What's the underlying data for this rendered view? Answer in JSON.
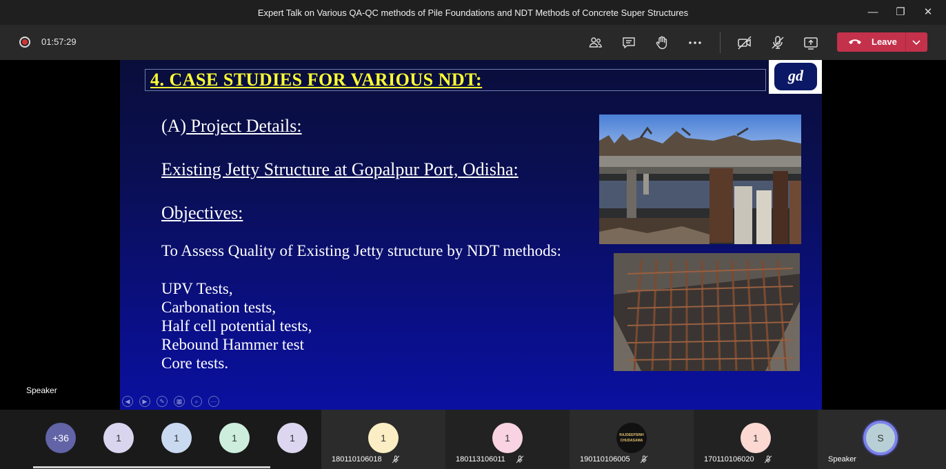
{
  "window": {
    "title": "Expert Talk on Various QA-QC methods of Pile Foundations and NDT Methods of Concrete Super Structures",
    "minimize": "—",
    "restore": "❐",
    "close": "✕"
  },
  "toolbar": {
    "timer": "01:57:29",
    "leave_label": "Leave",
    "icons": [
      "participants-icon",
      "chat-icon",
      "raise-hand-icon",
      "more-options-icon",
      "camera-off-icon",
      "mic-off-icon",
      "share-screen-icon"
    ],
    "leave_color": "#c4314b"
  },
  "slide": {
    "heading": "4.  CASE STUDIES FOR VARIOUS NDT:",
    "logo_text": "gd",
    "project_prefix": "(A)",
    "project_title": " Project Details:",
    "location": "Existing Jetty Structure at Gopalpur Port,  Odisha:",
    "objectives_heading": "Objectives:",
    "objective_text": "To Assess Quality of Existing Jetty structure by NDT methods:",
    "tests": [
      "UPV Tests,",
      "Carbonation tests,",
      "Half cell potential tests,",
      "Rebound Hammer test",
      "Core tests."
    ],
    "heading_color": "#ffff33"
  },
  "stage": {
    "speaker_label": "Speaker"
  },
  "participants": [
    {
      "label": "+36",
      "color": "#6264a7"
    },
    {
      "label": "1",
      "color": "#d9d5ee"
    },
    {
      "label": "1",
      "color": "#c9d9ef"
    },
    {
      "label": "1",
      "color": "#cdeedd"
    },
    {
      "label": "1",
      "color": "#ddd6f0"
    },
    {
      "label": "1",
      "name": "180110106018",
      "color": "#fbeec4"
    },
    {
      "label": "1",
      "name": "180113106011",
      "color": "#f9d3e2"
    },
    {
      "label": "RAJDEEPSINH CHUDASAMA",
      "name": "190110106005",
      "color": "#111111"
    },
    {
      "label": "1",
      "name": "170110106020",
      "color": "#fbd8d2"
    },
    {
      "label": "S",
      "name": "Speaker",
      "color": "#b9cfd6"
    }
  ]
}
